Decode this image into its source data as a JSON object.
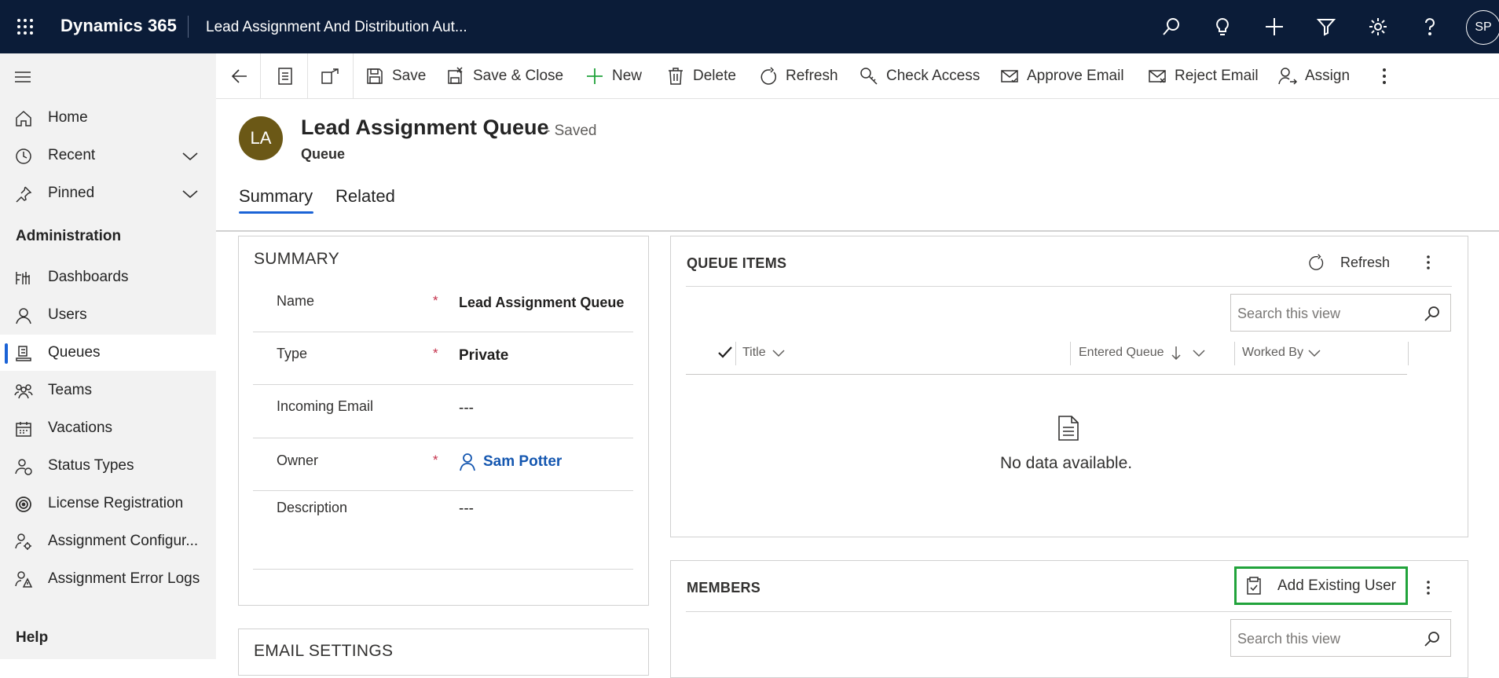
{
  "topbar": {
    "app_name": "Dynamics 365",
    "record_title": "Lead Assignment And Distribution Aut...",
    "avatar_initials": "SP",
    "icons": [
      "waffle-icon",
      "search-icon",
      "lightbulb-icon",
      "plus-icon",
      "filter-icon",
      "gear-icon",
      "help-icon"
    ]
  },
  "sidebar": {
    "items": [
      {
        "label": "Home",
        "icon": "home-icon"
      },
      {
        "label": "Recent",
        "icon": "clock-icon",
        "expandable": true
      },
      {
        "label": "Pinned",
        "icon": "pin-icon",
        "expandable": true
      }
    ],
    "section_admin": "Administration",
    "admin_items": [
      {
        "label": "Dashboards",
        "icon": "dashboard-icon"
      },
      {
        "label": "Users",
        "icon": "user-icon"
      },
      {
        "label": "Queues",
        "icon": "queue-icon",
        "active": true
      },
      {
        "label": "Teams",
        "icon": "team-icon"
      },
      {
        "label": "Vacations",
        "icon": "calendar-icon"
      },
      {
        "label": "Status Types",
        "icon": "status-icon"
      },
      {
        "label": "License Registration",
        "icon": "license-icon"
      },
      {
        "label": "Assignment Configur...",
        "icon": "config-icon"
      },
      {
        "label": "Assignment Error Logs",
        "icon": "error-log-icon"
      }
    ],
    "section_help": "Help"
  },
  "commandbar": {
    "save": "Save",
    "save_close": "Save & Close",
    "new": "New",
    "delete": "Delete",
    "refresh": "Refresh",
    "check_access": "Check Access",
    "approve_email": "Approve Email",
    "reject_email": "Reject Email",
    "assign": "Assign"
  },
  "header": {
    "avatar_initials": "LA",
    "avatar_color": "#6b5816",
    "title": "Lead Assignment Queue",
    "status": "- Saved",
    "entity": "Queue",
    "tabs": [
      "Summary",
      "Related"
    ],
    "active_tab": "Summary"
  },
  "summary": {
    "title": "SUMMARY",
    "fields": [
      {
        "label": "Name",
        "required": true,
        "value": "Lead Assignment Queue"
      },
      {
        "label": "Type",
        "required": true,
        "value": "Private"
      },
      {
        "label": "Incoming Email",
        "required": false,
        "value": "---"
      },
      {
        "label": "Owner",
        "required": true,
        "value": "Sam Potter"
      },
      {
        "label": "Description",
        "required": false,
        "value": "---"
      }
    ],
    "required_marker": "*"
  },
  "email_settings": {
    "title": "EMAIL SETTINGS"
  },
  "queue_items": {
    "title": "QUEUE ITEMS",
    "refresh_label": "Refresh",
    "search_placeholder": "Search this view",
    "columns": [
      "Title",
      "Entered Queue",
      "Worked By"
    ],
    "empty_text": "No data available."
  },
  "members": {
    "title": "MEMBERS",
    "add_label": "Add Existing User",
    "search_placeholder": "Search this view"
  },
  "colors": {
    "topbar": "#0b1c38",
    "accent": "#1b63d6",
    "highlight": "#21a33b",
    "required": "#c4314b",
    "link": "#1557b0"
  }
}
